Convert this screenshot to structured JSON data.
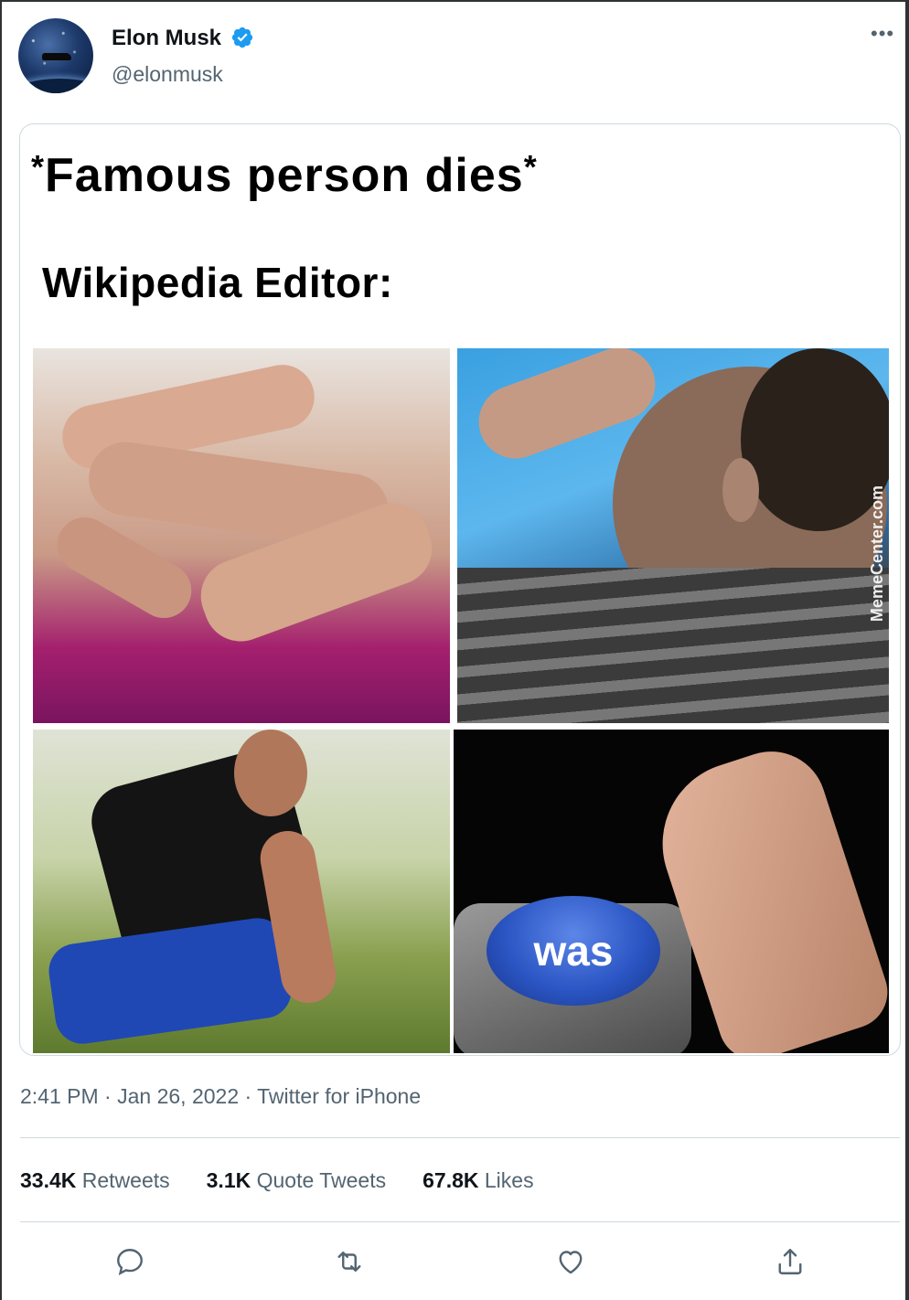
{
  "author": {
    "name": "Elon Musk",
    "handle": "@elonmusk",
    "verified": true,
    "verified_color": "#1d9bf0"
  },
  "media": {
    "caption_top": "Famous person dies",
    "caption_sub": "Wikipedia Editor:",
    "button_text": "was",
    "watermark": "MemeCenter.com"
  },
  "meta": {
    "time": "2:41 PM",
    "date": "Jan 26, 2022",
    "source": "Twitter for iPhone"
  },
  "stats": {
    "retweets_count": "33.4K",
    "retweets_label": "Retweets",
    "quotes_count": "3.1K",
    "quotes_label": "Quote Tweets",
    "likes_count": "67.8K",
    "likes_label": "Likes"
  },
  "actions": {
    "icons": [
      "reply-icon",
      "retweet-icon",
      "like-icon",
      "share-icon"
    ]
  },
  "colors": {
    "text_primary": "#0f1419",
    "text_secondary": "#536471",
    "border": "#cfd9de"
  }
}
